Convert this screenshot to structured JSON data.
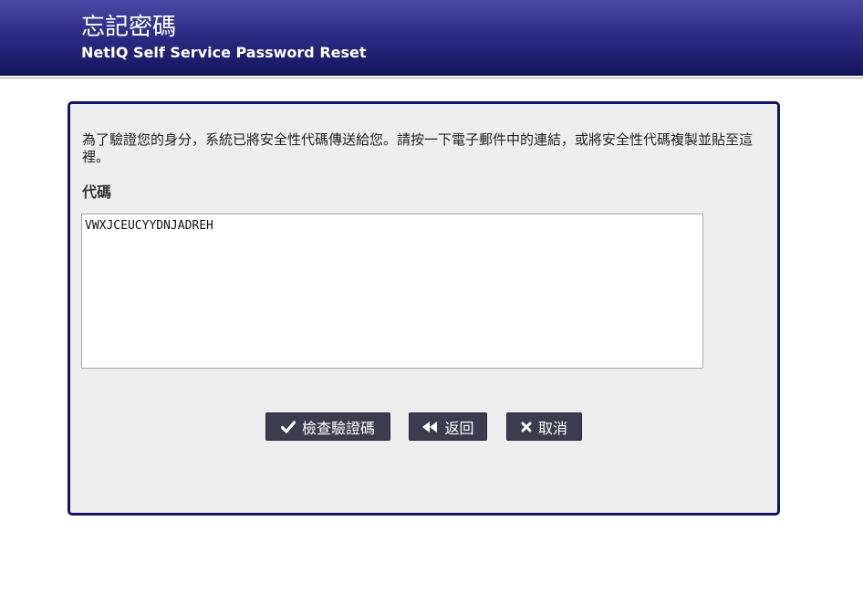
{
  "header": {
    "title": "忘記密碼",
    "subtitle": "NetIQ Self Service Password Reset"
  },
  "form": {
    "instructions": "為了驗證您的身分，系統已將安全性代碼傳送給您。請按一下電子郵件中的連結，或將安全性代碼複製並貼至這裡。",
    "code_label": "代碼",
    "code_value": "VWXJCEUCYYDNJADREH"
  },
  "buttons": {
    "check_label": "檢查驗證碼",
    "back_label": "返回",
    "cancel_label": "取消"
  },
  "icons": {
    "check": "checkmark-icon",
    "back": "double-chevron-left-icon",
    "cancel": "x-icon"
  },
  "colors": {
    "header_dark": "#14145e",
    "header_light": "#4a4aa6",
    "panel_border": "#15156a",
    "panel_bg": "#eeeeee",
    "button_bg": "#3d3b4e"
  }
}
